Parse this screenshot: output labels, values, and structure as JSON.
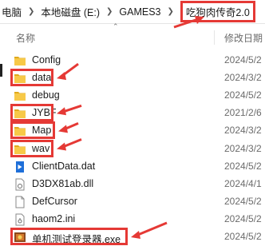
{
  "breadcrumb": {
    "items": [
      "电脑",
      "本地磁盘 (E:)",
      "GAMES3",
      "吃狗肉传奇2.0"
    ]
  },
  "columns": {
    "name": "名称",
    "date_modified": "修改日期"
  },
  "files": [
    {
      "name": "Config",
      "date": "2024/5/2",
      "type": "folder"
    },
    {
      "name": "data",
      "date": "2024/3/2",
      "type": "folder"
    },
    {
      "name": "debug",
      "date": "2024/5/2",
      "type": "folder"
    },
    {
      "name": "JYBF",
      "date": "2021/2/6",
      "type": "folder"
    },
    {
      "name": "Map",
      "date": "2024/3/2",
      "type": "folder"
    },
    {
      "name": "wav",
      "date": "2024/3/2",
      "type": "folder"
    },
    {
      "name": "ClientData.dat",
      "date": "2024/5/2",
      "type": "dat"
    },
    {
      "name": "D3DX81ab.dll",
      "date": "2024/4/1",
      "type": "dll"
    },
    {
      "name": "DefCursor",
      "date": "2024/5/2",
      "type": "file"
    },
    {
      "name": "haom2.ini",
      "date": "2024/5/2",
      "type": "ini"
    },
    {
      "name": "单机测试登录器.exe",
      "date": "2024/5/2",
      "type": "exe"
    }
  ],
  "colors": {
    "annotation": "#e53935",
    "folder": "#f7c948",
    "folder_tab": "#e0a91c",
    "dat_icon": "#1e6fd9"
  }
}
